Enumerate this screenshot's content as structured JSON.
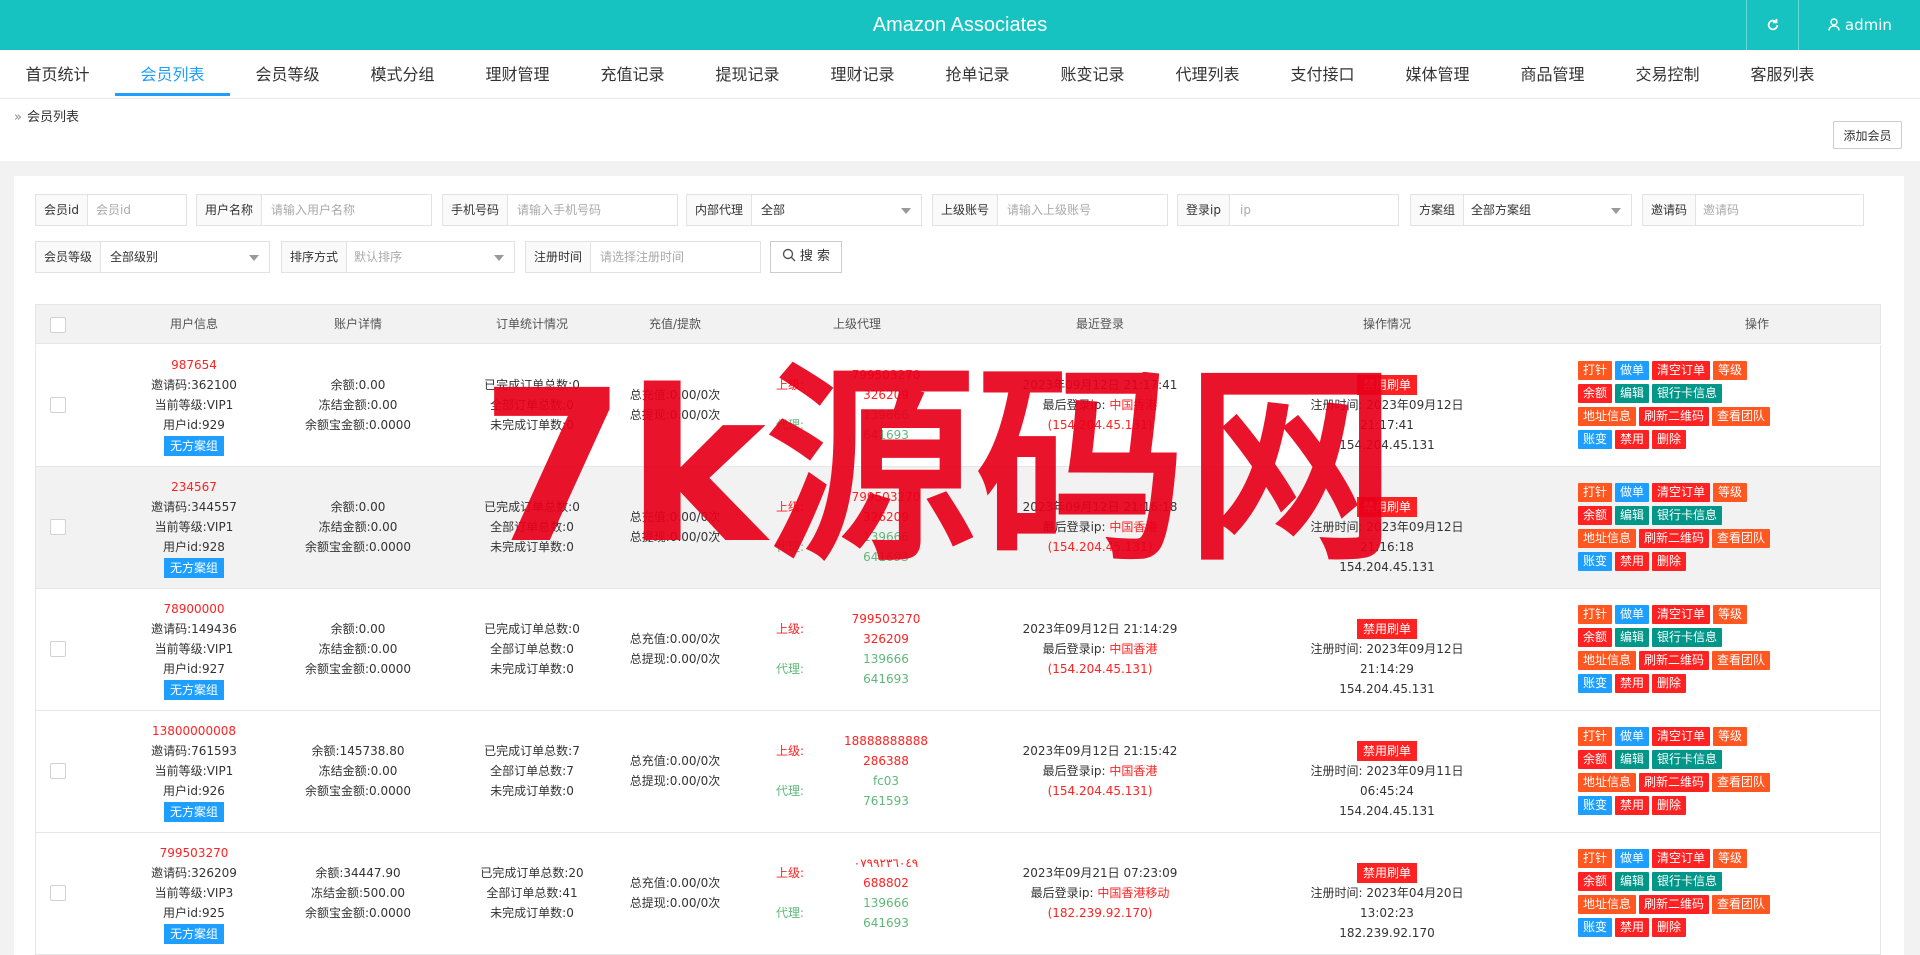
{
  "app": {
    "title": "Amazon Associates",
    "user": "admin",
    "refresh_icon": "refresh-icon",
    "user_icon": "user-icon"
  },
  "nav": [
    {
      "label": "首页统计"
    },
    {
      "label": "会员列表"
    },
    {
      "label": "会员等级"
    },
    {
      "label": "模式分组"
    },
    {
      "label": "理财管理"
    },
    {
      "label": "充值记录"
    },
    {
      "label": "提现记录"
    },
    {
      "label": "理财记录"
    },
    {
      "label": "抢单记录"
    },
    {
      "label": "账变记录"
    },
    {
      "label": "代理列表"
    },
    {
      "label": "支付接口"
    },
    {
      "label": "媒体管理"
    },
    {
      "label": "商品管理"
    },
    {
      "label": "交易控制"
    },
    {
      "label": "客服列表"
    }
  ],
  "active_nav": "会员列表",
  "breadcrumb": "会员列表",
  "add_button": "添加会员",
  "filters": {
    "member_id": {
      "label": "会员id",
      "placeholder": "会员id"
    },
    "username": {
      "label": "用户名称",
      "placeholder": "请输入用户名称"
    },
    "phone": {
      "label": "手机号码",
      "placeholder": "请输入手机号码"
    },
    "internal_agent": {
      "label": "内部代理",
      "value": "全部"
    },
    "parent_account": {
      "label": "上级账号",
      "placeholder": "请输入上级账号"
    },
    "login_ip": {
      "label": "登录ip",
      "placeholder": "ip"
    },
    "plan_group": {
      "label": "方案组",
      "value": "全部方案组"
    },
    "invite_code": {
      "label": "邀请码",
      "placeholder": "邀请码"
    },
    "member_level": {
      "label": "会员等级",
      "value": "全部级别"
    },
    "sort": {
      "label": "排序方式",
      "value": "默认排序"
    },
    "register_time": {
      "label": "注册时间",
      "placeholder": "请选择注册时间"
    },
    "search_button": "搜 索"
  },
  "columns": [
    "用户信息",
    "账户详情",
    "订单统计情况",
    "充值/提款",
    "上级代理",
    "最近登录",
    "操作情况",
    "操作"
  ],
  "op_buttons": {
    "b1": "打针",
    "b2": "做单",
    "b3": "清空订单",
    "b4": "等级",
    "b5": "余额",
    "b6": "编辑",
    "b7": "银行卡信息",
    "b8": "地址信息",
    "b9": "刷新二维码",
    "b10": "查看团队",
    "b11": "账变",
    "b12": "禁用",
    "b13": "删除"
  },
  "rows": [
    {
      "account": "987654",
      "invite": "邀请码:362100",
      "level": "当前等级:VIP1",
      "uid": "用户id:929",
      "group": "无方案组",
      "balance": "余额:0.00",
      "frozen": "冻结金额:0.00",
      "yeb": "余额宝金额:0.0000",
      "done": "已完成订单总数:0",
      "total": "全部订单总数:0",
      "undone": "未完成订单数:0",
      "recharge": "总充值:0.00/0次",
      "withdraw": "总提现:0.00/0次",
      "up_label": "上级:",
      "up1": "799503270",
      "up2": "326209",
      "agent_label": "代理:",
      "ag1": "139666",
      "ag2": "641693",
      "login_time": "2023年09月12日 21:17:41",
      "login_ip_label": "最后登录ip:",
      "login_loc": "中国香港",
      "login_ip": "(154.204.45.131)",
      "status": "禁用刷单",
      "reg_label": "注册时间:",
      "reg_time": "2023年09月12日 21:17:41",
      "reg_ip": "154.204.45.131"
    },
    {
      "account": "234567",
      "invite": "邀请码:344557",
      "level": "当前等级:VIP1",
      "uid": "用户id:928",
      "group": "无方案组",
      "balance": "余额:0.00",
      "frozen": "冻结金额:0.00",
      "yeb": "余额宝金额:0.0000",
      "done": "已完成订单总数:0",
      "total": "全部订单总数:0",
      "undone": "未完成订单数:0",
      "recharge": "总充值:0.00/0次",
      "withdraw": "总提现:0.00/0次",
      "up_label": "上级:",
      "up1": "799503270",
      "up2": "326209",
      "agent_label": "代理:",
      "ag1": "139666",
      "ag2": "641693",
      "login_time": "2023年09月12日 21:16:18",
      "login_ip_label": "最后登录ip:",
      "login_loc": "中国香港",
      "login_ip": "(154.204.45.131)",
      "status": "禁用刷单",
      "reg_label": "注册时间:",
      "reg_time": "2023年09月12日 21:16:18",
      "reg_ip": "154.204.45.131"
    },
    {
      "account": "78900000",
      "invite": "邀请码:149436",
      "level": "当前等级:VIP1",
      "uid": "用户id:927",
      "group": "无方案组",
      "balance": "余额:0.00",
      "frozen": "冻结金额:0.00",
      "yeb": "余额宝金额:0.0000",
      "done": "已完成订单总数:0",
      "total": "全部订单总数:0",
      "undone": "未完成订单数:0",
      "recharge": "总充值:0.00/0次",
      "withdraw": "总提现:0.00/0次",
      "up_label": "上级:",
      "up1": "799503270",
      "up2": "326209",
      "agent_label": "代理:",
      "ag1": "139666",
      "ag2": "641693",
      "login_time": "2023年09月12日 21:14:29",
      "login_ip_label": "最后登录ip:",
      "login_loc": "中国香港",
      "login_ip": "(154.204.45.131)",
      "status": "禁用刷单",
      "reg_label": "注册时间:",
      "reg_time": "2023年09月12日 21:14:29",
      "reg_ip": "154.204.45.131"
    },
    {
      "account": "13800000008",
      "invite": "邀请码:761593",
      "level": "当前等级:VIP1",
      "uid": "用户id:926",
      "group": "无方案组",
      "balance": "余额:145738.80",
      "frozen": "冻结金额:0.00",
      "yeb": "余额宝金额:0.0000",
      "done": "已完成订单总数:7",
      "total": "全部订单总数:7",
      "undone": "未完成订单数:0",
      "recharge": "总充值:0.00/0次",
      "withdraw": "总提现:0.00/0次",
      "up_label": "上级:",
      "up1": "18888888888",
      "up2": "286388",
      "agent_label": "代理:",
      "ag1": "fc03",
      "ag2": "761593",
      "login_time": "2023年09月12日 21:15:42",
      "login_ip_label": "最后登录ip:",
      "login_loc": "中国香港",
      "login_ip": "(154.204.45.131)",
      "status": "禁用刷单",
      "reg_label": "注册时间:",
      "reg_time": "2023年09月11日 06:45:24",
      "reg_ip": "154.204.45.131"
    },
    {
      "account": "799503270",
      "invite": "邀请码:326209",
      "level": "当前等级:VIP3",
      "uid": "用户id:925",
      "group": "无方案组",
      "balance": "余额:34447.90",
      "frozen": "冻结金额:500.00",
      "yeb": "余额宝金额:0.0000",
      "done": "已完成订单总数:20",
      "total": "全部订单总数:41",
      "undone": "未完成订单数:0",
      "recharge": "总充值:0.00/0次",
      "withdraw": "总提现:0.00/0次",
      "up_label": "上级:",
      "up1": "٠٧٩٩٢٣٦٠٤٩",
      "up2": "688802",
      "agent_label": "代理:",
      "ag1": "139666",
      "ag2": "641693",
      "login_time": "2023年09月21日 07:23:09",
      "login_ip_label": "最后登录ip:",
      "login_loc": "中国香港移动",
      "login_ip": "(182.239.92.170)",
      "status": "禁用刷单",
      "reg_label": "注册时间:",
      "reg_time": "2023年04月20日 13:02:23",
      "reg_ip": "182.239.92.170"
    }
  ],
  "watermark": "7k源码网"
}
